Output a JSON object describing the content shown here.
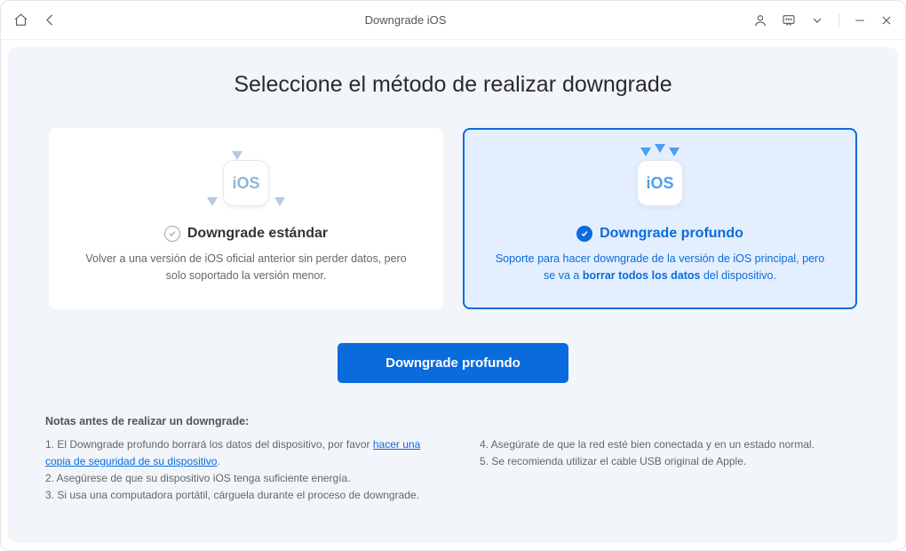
{
  "titlebar": {
    "title": "Downgrade iOS"
  },
  "page": {
    "heading": "Seleccione el método de realizar downgrade"
  },
  "cards": {
    "standard": {
      "title": "Downgrade estándar",
      "desc": "Volver a una versión de iOS oficial anterior sin perder datos, pero solo soportado la versión menor.",
      "ios_label": "iOS"
    },
    "deep": {
      "title": "Downgrade profundo",
      "desc_pre": "Soporte para hacer downgrade de la versión de iOS principal, pero se va a ",
      "desc_bold": "borrar todos los datos",
      "desc_post": " del dispositivo.",
      "ios_label": "iOS"
    }
  },
  "action": {
    "primary": "Downgrade profundo"
  },
  "notes": {
    "heading": "Notas antes de realizar un downgrade:",
    "n1_pre": "1.  El Downgrade profundo borrará los datos del dispositivo, por favor ",
    "n1_link": "hacer una copia de seguridad de su dispositivo",
    "n1_post": ".",
    "n2": "2.  Asegúrese de que su dispositivo iOS tenga suficiente energía.",
    "n3": "3.  Si usa una computadora portátil, cárguela durante el proceso de downgrade.",
    "n4": "4.  Asegúrate de que la red esté bien conectada y en un estado normal.",
    "n5": "5.  Se recomienda utilizar el cable USB original de Apple."
  }
}
